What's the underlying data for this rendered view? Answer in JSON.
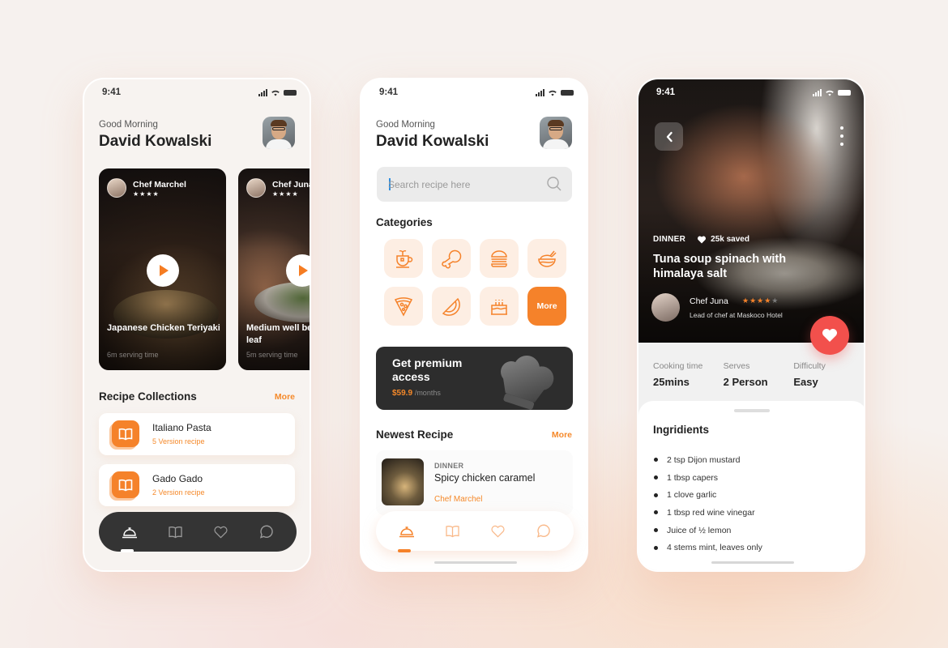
{
  "colors": {
    "accent": "#f5822a",
    "accent_light": "#fdeee3",
    "dark": "#2d2d2d",
    "heart_red": "#f2504c",
    "background": "#f6f1ee"
  },
  "status_bar": {
    "time": "9:41",
    "icons": [
      "signal-icon",
      "wifi-icon",
      "battery-icon"
    ]
  },
  "screen_home": {
    "greeting": "Good Morning",
    "user_name": "David Kowalski",
    "video_cards": [
      {
        "chef": "Chef Marchel",
        "rating": "★★★★",
        "title": "Japanese Chicken Teriyaki",
        "subtitle": "6m serving time"
      },
      {
        "chef": "Chef Juna",
        "rating": "★★★★",
        "title": "Medium well beef kemangi leaf",
        "subtitle": "5m serving time"
      }
    ],
    "collections_title": "Recipe Collections",
    "collections_more": "More",
    "collections": [
      {
        "name": "Italiano Pasta",
        "count": "5 Version recipe"
      },
      {
        "name": "Gado Gado",
        "count": "2 Version recipe"
      }
    ],
    "tabs": [
      "home",
      "recipes",
      "favorites",
      "messages"
    ],
    "active_tab": "home"
  },
  "screen_search": {
    "greeting": "Good Morning",
    "user_name": "David Kowalski",
    "search_placeholder": "Search recipe here",
    "search_value": "",
    "categories_title": "Categories",
    "categories": [
      "tea",
      "chicken",
      "burger",
      "rice-bowl",
      "pizza",
      "watermelon",
      "cake"
    ],
    "categories_more": "More",
    "premium": {
      "title": "Get premium access",
      "price": "$59.9",
      "period": "/months"
    },
    "newest_title": "Newest Recipe",
    "newest_more": "More",
    "newest": {
      "tag": "DINNER",
      "title": "Spicy chicken caramel",
      "chef": "Chef Marchel"
    },
    "tabs": [
      "home",
      "recipes",
      "favorites",
      "messages"
    ],
    "active_tab": "home"
  },
  "screen_detail": {
    "tag": "DINNER",
    "saved": "25k saved",
    "title": "Tuna soup spinach with himalaya salt",
    "chef_name": "Chef Juna",
    "chef_rating": 4,
    "chef_rating_max": 5,
    "chef_stars_filled": "★★★★",
    "chef_stars_empty": "★",
    "chef_role": "Lead of chef at Maskoco Hotel",
    "stats": [
      {
        "label": "Cooking time",
        "value": "25mins"
      },
      {
        "label": "Serves",
        "value": "2 Person"
      },
      {
        "label": "Difficulty",
        "value": "Easy"
      }
    ],
    "ingredients_title": "Ingridients",
    "ingredients": [
      "2 tsp Dijon mustard",
      "1 tbsp capers",
      "1 clove garlic",
      "1 tbsp red wine vinegar",
      "Juice of ½ lemon",
      "4 stems mint, leaves only"
    ]
  }
}
